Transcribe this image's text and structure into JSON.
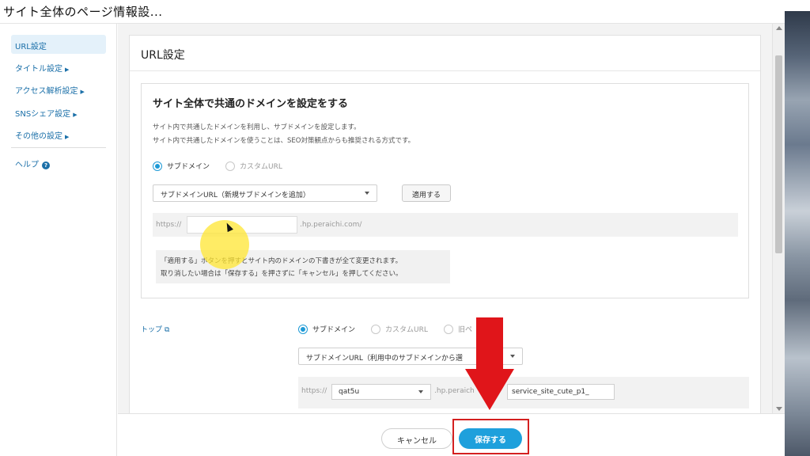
{
  "window": {
    "title": "サイト全体のページ情報設..."
  },
  "sidebar": {
    "items": [
      {
        "label": "URL設定",
        "active": true
      },
      {
        "label": "タイトル設定"
      },
      {
        "label": "アクセス解析設定"
      },
      {
        "label": "SNSシェア設定"
      },
      {
        "label": "その他の設定"
      }
    ],
    "help_label": "ヘルプ"
  },
  "panel": {
    "title": "URL設定",
    "domain_section": {
      "heading": "サイト全体で共通のドメインを設定をする",
      "description_lines": [
        "サイト内で共通したドメインを利用し、サブドメインを設定します。",
        "サイト内で共通したドメインを使うことは、SEO対策観点からも推奨される方式です。"
      ],
      "radio_options": [
        {
          "label": "サブドメイン",
          "selected": true
        },
        {
          "label": "カスタムURL",
          "selected": false
        }
      ],
      "select_value": "サブドメインURL（新規サブドメインを追加）",
      "apply_button": "適用する",
      "url_prefix": "https://",
      "url_input_value": "",
      "url_suffix": ".hp.peraichi.com/",
      "notice_lines": [
        "「適用する」ボタンを押すとサイト内のドメインの下書きが全て変更されます。",
        "取り消したい場合は「保存する」を押さずに「キャンセル」を押してください。"
      ]
    },
    "page_rows": [
      {
        "label": "トップ",
        "radio_options": [
          {
            "label": "サブドメイン",
            "selected": true
          },
          {
            "label": "カスタムURL",
            "selected": false
          },
          {
            "label": "旧ペ",
            "suffix": "L",
            "selected": false
          }
        ],
        "select_value": "サブドメインURL（利用中のサブドメインから選",
        "url_prefix": "https://",
        "subdomain_value": "qat5u",
        "url_middle": ".hp.peraich",
        "slug_value": "service_site_cute_p1_"
      }
    ]
  },
  "footer": {
    "cancel_label": "キャンセル",
    "save_label": "保存する"
  },
  "colors": {
    "accent": "#1ea0dc",
    "link": "#1a6fa8",
    "annotation_red": "#e0151a"
  }
}
